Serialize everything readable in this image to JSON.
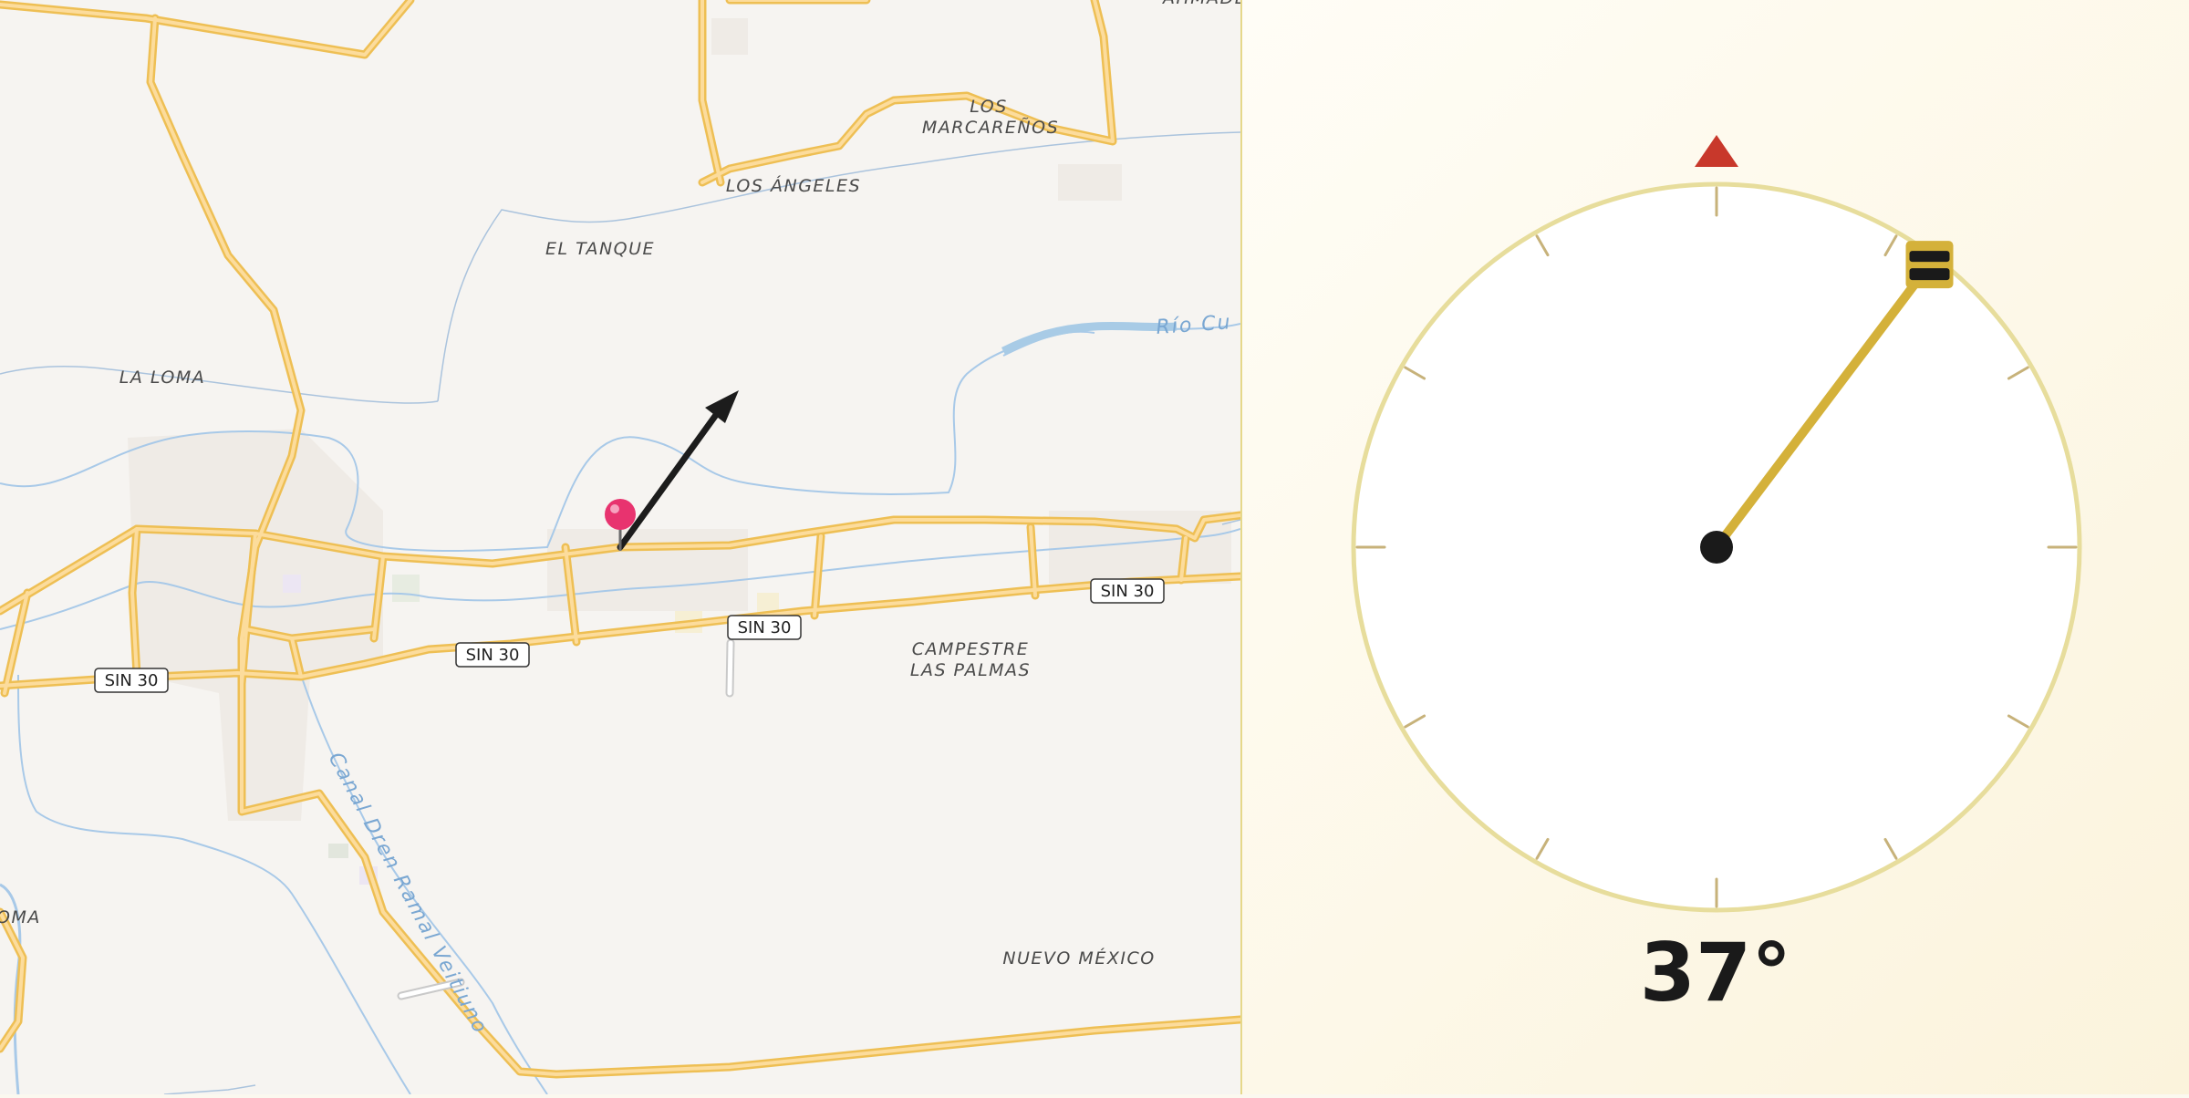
{
  "map": {
    "place_labels": {
      "los_marcarenos_1": "LOS",
      "los_marcarenos_2": "MARCAREÑOS",
      "los_angeles": "LOS ÁNGELES",
      "el_tanque": "EL TANQUE",
      "la_loma": "LA LOMA",
      "campestre_1": "CAMPESTRE",
      "campestre_2": "LAS PALMAS",
      "nuevo_mexico": "NUEVO MÉXICO",
      "loma_edge": "OMA",
      "top_edge": "AHMADE"
    },
    "water_labels": {
      "rio": "Río Cu",
      "canal": "Canal Dren Ramal Veitiuno"
    },
    "route_shields": {
      "shield_1": "SIN 30",
      "shield_2": "SIN 30",
      "shield_3": "SIN 30",
      "shield_4": "SIN 30"
    },
    "pin_color": "#e8336f",
    "direction_arrow": "heading-arrow-icon"
  },
  "compass": {
    "heading_degrees": 37,
    "heading_text": "37°",
    "north_marker": "north-triangle-icon",
    "north_color": "#c8382b",
    "needle_color": "#d4b13a",
    "ring_color": "#e7dd9c"
  }
}
